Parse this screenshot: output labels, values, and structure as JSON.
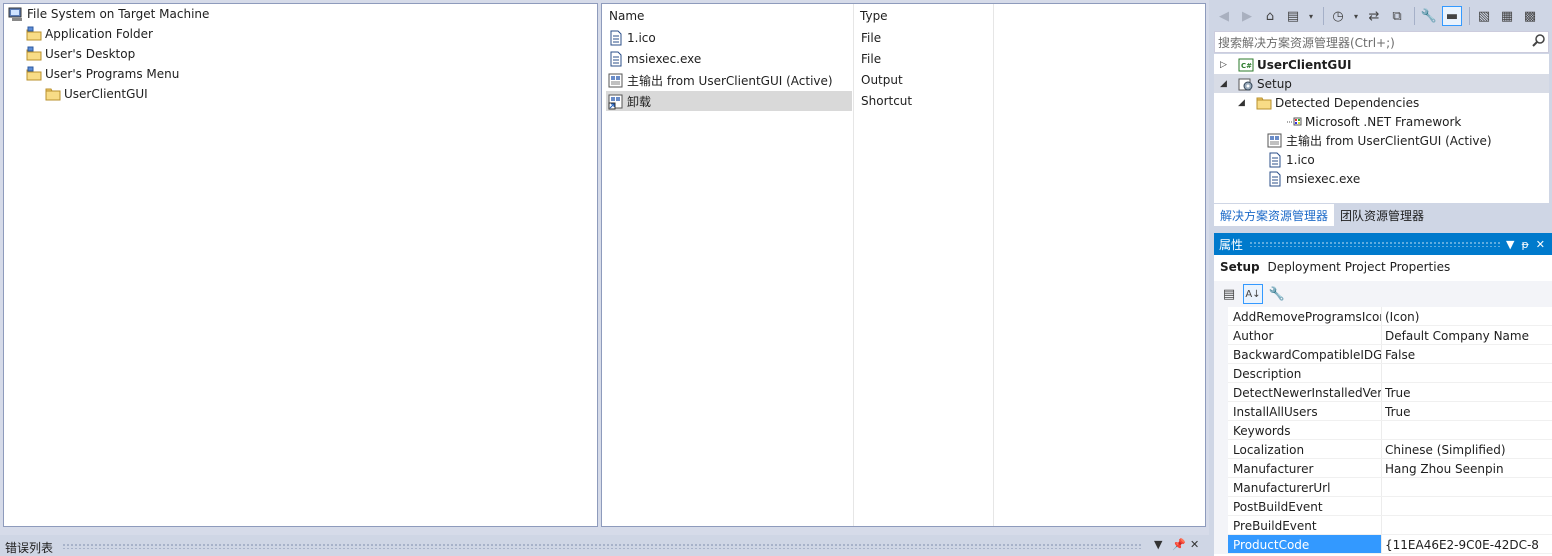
{
  "file_system": {
    "root": "File System on Target Machine",
    "folders": [
      "Application Folder",
      "User's Desktop",
      "User's Programs Menu"
    ],
    "subfolder": "UserClientGUI"
  },
  "file_list": {
    "headers": {
      "name": "Name",
      "type": "Type"
    },
    "rows": [
      {
        "name": "1.ico",
        "type": "File",
        "icon": "file-icon"
      },
      {
        "name": "msiexec.exe",
        "type": "File",
        "icon": "file-icon"
      },
      {
        "name": "主输出 from UserClientGUI (Active)",
        "type": "Output",
        "icon": "project-output-icon"
      },
      {
        "name": "卸载",
        "type": "Shortcut",
        "icon": "shortcut-icon",
        "selected": true
      }
    ]
  },
  "solution_explorer": {
    "search_placeholder": "搜索解决方案资源管理器(Ctrl+;)",
    "items": [
      {
        "label": "UserClientGUI",
        "icon": "csharp-project-icon",
        "bold": true
      },
      {
        "label": "Setup",
        "icon": "setup-project-icon",
        "selected": true
      },
      {
        "label": "Detected Dependencies",
        "icon": "folder-icon"
      },
      {
        "label": "Microsoft .NET Framework",
        "icon": "dependency-icon"
      },
      {
        "label": "主输出 from UserClientGUI (Active)",
        "icon": "project-output-icon"
      },
      {
        "label": "1.ico",
        "icon": "file-icon"
      },
      {
        "label": "msiexec.exe",
        "icon": "file-icon"
      }
    ],
    "tabs": [
      {
        "label": "解决方案资源管理器",
        "active": true
      },
      {
        "label": "团队资源管理器",
        "active": false
      }
    ]
  },
  "properties": {
    "title": "属性",
    "object_name": "Setup",
    "object_type": "Deployment Project Properties",
    "rows": [
      {
        "name": "AddRemoveProgramsIcon",
        "value": "(Icon)"
      },
      {
        "name": "Author",
        "value": "Default Company Name"
      },
      {
        "name": "BackwardCompatibleIDGeneration",
        "value": "False"
      },
      {
        "name": "Description",
        "value": ""
      },
      {
        "name": "DetectNewerInstalledVersion",
        "value": "True"
      },
      {
        "name": "InstallAllUsers",
        "value": "True"
      },
      {
        "name": "Keywords",
        "value": ""
      },
      {
        "name": "Localization",
        "value": "Chinese (Simplified)"
      },
      {
        "name": "Manufacturer",
        "value": "Hang Zhou Seenpin"
      },
      {
        "name": "ManufacturerUrl",
        "value": ""
      },
      {
        "name": "PostBuildEvent",
        "value": ""
      },
      {
        "name": "PreBuildEvent",
        "value": ""
      },
      {
        "name": "ProductCode",
        "value": "{11EA46E2-9C0E-42DC-8",
        "selected": true
      }
    ]
  },
  "bottom_panel": {
    "title": "错误列表"
  },
  "colors": {
    "accent": "#007acc",
    "selection": "#3399ff",
    "chrome": "#cfd6e5"
  }
}
